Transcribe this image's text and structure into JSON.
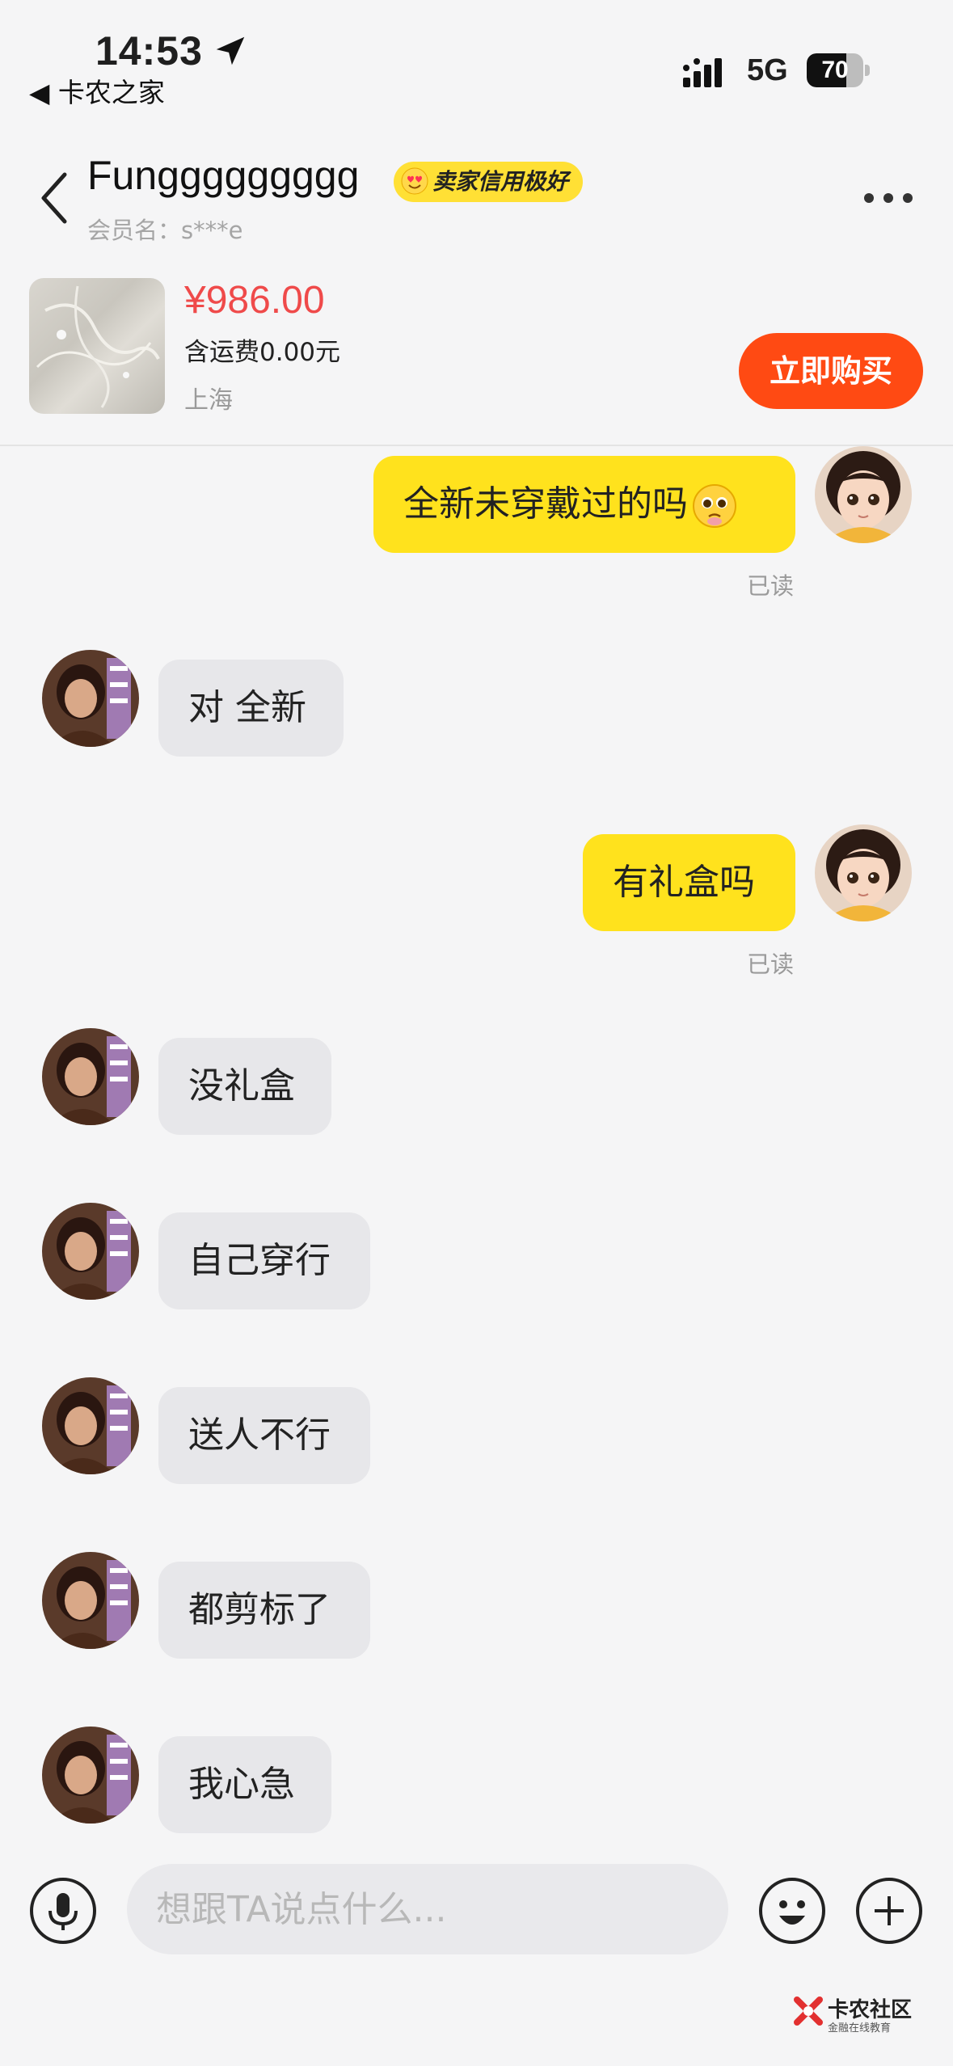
{
  "status_bar": {
    "time": "14:53",
    "back_app": "◀ 卡农之家",
    "network": "5G",
    "battery": "70",
    "battery_level": 0.7
  },
  "header": {
    "seller_name": "Funggggggggg",
    "credit_badge": "卖家信用极好",
    "member_label": "会员名：",
    "member_value": "s***e"
  },
  "product": {
    "price": "¥986.00",
    "shipping": "含运费0.00元",
    "location": "上海",
    "buy_label": "立即购买"
  },
  "messages": [
    {
      "from": "me",
      "text": "全新未穿戴过的吗",
      "emoji": "pleading-face",
      "read": "已读"
    },
    {
      "from": "them",
      "text": "对 全新"
    },
    {
      "from": "me",
      "text": "有礼盒吗",
      "read": "已读"
    },
    {
      "from": "them",
      "text": "没礼盒"
    },
    {
      "from": "them",
      "text": "自己穿行"
    },
    {
      "from": "them",
      "text": "送人不行"
    },
    {
      "from": "them",
      "text": "都剪标了"
    },
    {
      "from": "them",
      "text": "我心急"
    }
  ],
  "input": {
    "placeholder": "想跟TA说点什么..."
  },
  "watermark": {
    "title": "卡农社区",
    "subtitle": "金融在线教育"
  },
  "colors": {
    "my_bubble": "#ffe21d",
    "their_bubble": "#e7e7ea",
    "price": "#ef4a4a",
    "buy_button": "#ff4a13",
    "badge": "#ffe035"
  }
}
